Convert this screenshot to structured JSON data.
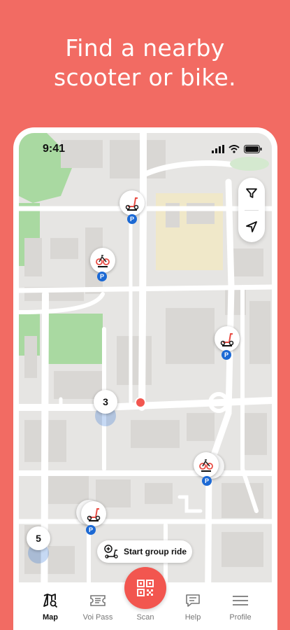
{
  "headline": {
    "line1": "Find a nearby",
    "line2": "scooter or bike."
  },
  "status_bar": {
    "time": "9:41"
  },
  "map": {
    "clusters": [
      {
        "count": "3"
      },
      {
        "count": "5"
      }
    ],
    "parking_badge": "P",
    "group_ride_label": "Start group ride"
  },
  "tabbar": {
    "items": [
      {
        "label": "Map",
        "icon": "map-search-icon",
        "active": true
      },
      {
        "label": "Voi Pass",
        "icon": "ticket-icon",
        "active": false
      },
      {
        "label": "Scan",
        "icon": "qr-code-icon",
        "active": false
      },
      {
        "label": "Help",
        "icon": "chat-icon",
        "active": false
      },
      {
        "label": "Profile",
        "icon": "menu-icon",
        "active": false
      }
    ]
  },
  "colors": {
    "brand": "#F26B63",
    "accent": "#F2564F",
    "parking": "#1C69D4",
    "park_green": "#A9D9A1"
  }
}
